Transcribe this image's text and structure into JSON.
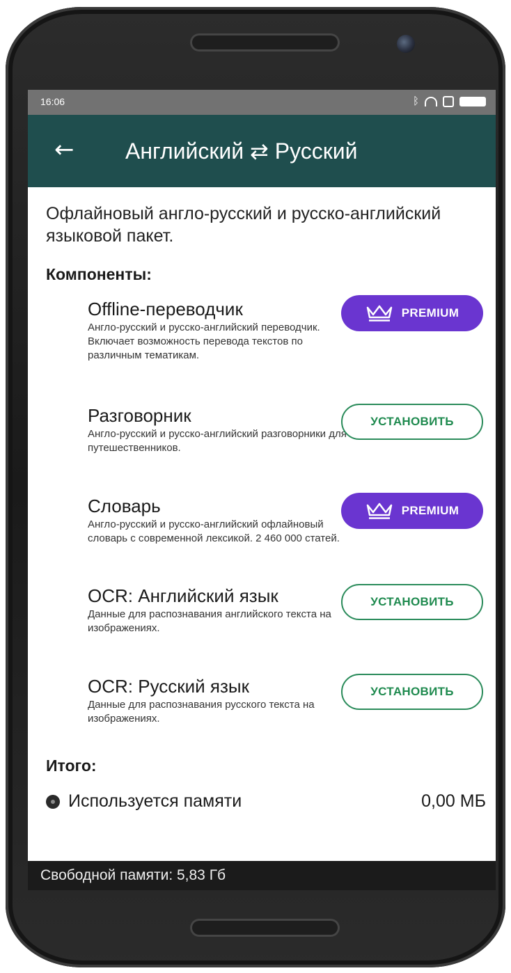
{
  "status": {
    "time": "16:06"
  },
  "appbar": {
    "title": "Английский ⇄ Русский"
  },
  "intro": "Офлайновый англо-русский и русско-английский языковой пакет.",
  "components_title": "Компоненты:",
  "components": [
    {
      "title": "Offline-переводчик",
      "description": "Англо-русский и русско-английский переводчик. Включает возможность перевода текстов по различным тематикам.",
      "action": "PREMIUM",
      "action_type": "premium"
    },
    {
      "title": "Разговорник",
      "description": "Англо-русский и русско-английский разговорники для путешественников.",
      "action": "УСТАНОВИТЬ",
      "action_type": "install"
    },
    {
      "title": "Словарь",
      "description": "Англо-русский и русско-английский офлайновый словарь с современной лексикой. 2 460 000 статей.",
      "action": "PREMIUM",
      "action_type": "premium"
    },
    {
      "title": "OCR: Английский язык",
      "description": "Данные для распознавания английского текста на изображениях.",
      "action": "УСТАНОВИТЬ",
      "action_type": "install"
    },
    {
      "title": "OCR: Русский язык",
      "description": "Данные для распознавания русского текста на изображениях.",
      "action": "УСТАНОВИТЬ",
      "action_type": "install"
    }
  ],
  "total_title": "Итого:",
  "memory_used": {
    "label": "Используется памяти",
    "value": "0,00 МБ"
  },
  "footer": "Свободной памяти: 5,83 Гб",
  "colors": {
    "appbar": "#1f4e4e",
    "premium": "#6a35d0",
    "install": "#1f8a4f",
    "statusbar": "#727272"
  },
  "icons": {
    "back": "arrow-left-icon",
    "premium": "crown-icon",
    "memory": "disk-icon"
  }
}
